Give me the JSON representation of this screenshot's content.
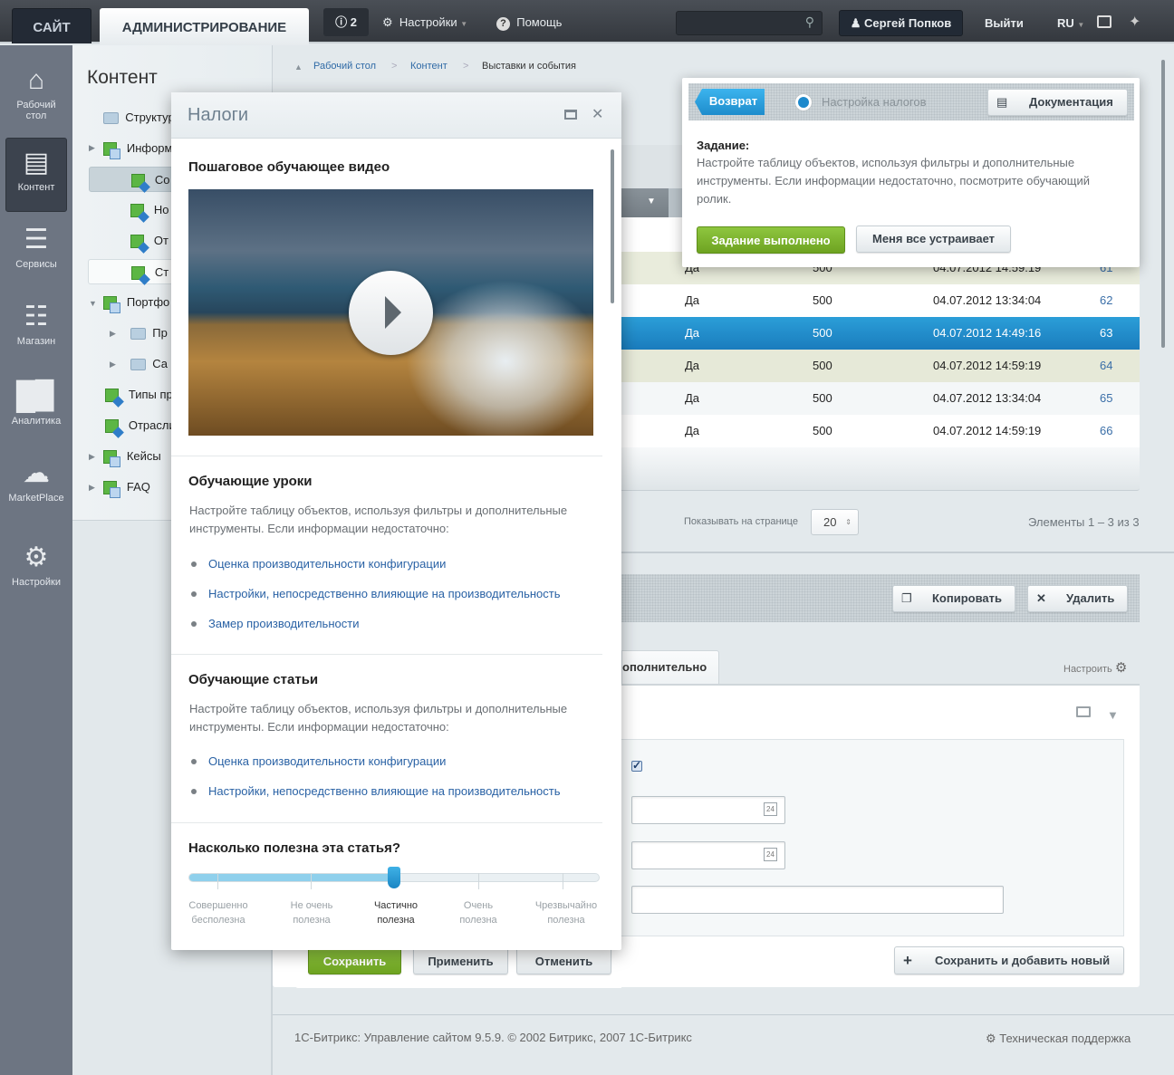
{
  "topbar": {
    "site_tab": "САЙТ",
    "admin_tab": "АДМИНИСТРИРОВАНИЕ",
    "notifications_count": "2",
    "settings": "Настройки",
    "help": "Помощь",
    "search_placeholder": "",
    "user": "Сергей Попков",
    "logout": "Выйти",
    "lang": "RU"
  },
  "leftnav": [
    {
      "label": "Рабочий стол",
      "icon": "home-icon"
    },
    {
      "label": "Контент",
      "icon": "document-icon",
      "active": true
    },
    {
      "label": "Сервисы",
      "icon": "layers-icon"
    },
    {
      "label": "Магазин",
      "icon": "basket-icon"
    },
    {
      "label": "Аналитика",
      "icon": "bar-chart-icon"
    },
    {
      "label": "MarketPlace",
      "icon": "cloud-download-icon"
    },
    {
      "label": "Настройки",
      "icon": "gear-icon"
    }
  ],
  "tree": {
    "title": "Контент",
    "items": [
      "Структура",
      "Информ",
      "Со",
      "Но",
      "От",
      "Ст",
      "Портфо",
      "Пр",
      "Са",
      "Типы пр",
      "Отрасли",
      "Кейсы",
      "FAQ"
    ]
  },
  "breadcrumb": [
    "Рабочий стол",
    "Контент",
    "Выставки и события"
  ],
  "table": {
    "rows": [
      {
        "active": "Да",
        "sort": "500",
        "date": "04.07.2012 14:59:19",
        "id": "61"
      },
      {
        "active": "Да",
        "sort": "500",
        "date": "04.07.2012 13:34:04",
        "id": "62"
      },
      {
        "active": "Да",
        "sort": "500",
        "date": "04.07.2012 14:49:16",
        "id": "63",
        "selected": true
      },
      {
        "active": "Да",
        "sort": "500",
        "date": "04.07.2012 14:59:19",
        "id": "64"
      },
      {
        "active": "Да",
        "sort": "500",
        "date": "04.07.2012 13:34:04",
        "id": "65"
      },
      {
        "active": "Да",
        "sort": "500",
        "date": "04.07.2012 14:59:19",
        "id": "66"
      }
    ]
  },
  "pagination": {
    "label": "Показывать на странице",
    "per_page": "20",
    "summary": "Элементы 1 – 3 из 3"
  },
  "toolbar": {
    "copy": "Копировать",
    "delete": "Удалить"
  },
  "tabs": {
    "extra": "ополнительно",
    "configure": "Настроить"
  },
  "form": {
    "checkbox_checked": true,
    "date1": "",
    "date2": "",
    "text": ""
  },
  "buttons": {
    "save": "Сохранить",
    "apply": "Применить",
    "cancel": "Отменить",
    "save_add": "Сохранить и добавить новый"
  },
  "footer": {
    "copyright": "1С-Битрикс: Управление сайтом 9.5.9. © 2002 Битрикс, 2007 1С-Битрикс",
    "support": "Техническая поддержка"
  },
  "modal": {
    "title": "Налоги",
    "video_heading": "Пошаговое обучающее видео",
    "lessons": {
      "heading": "Обучающие уроки",
      "text": "Настройте таблицу объектов, используя фильтры и дополнительные инструменты. Если информации недостаточно:",
      "links": [
        "Оценка производительности конфигурации",
        "Настройки, непосредственно влияющие на производительность",
        "Замер производительности"
      ]
    },
    "articles": {
      "heading": "Обучающие статьи",
      "text": "Настройте таблицу объектов, используя фильтры и дополнительные инструменты. Если информации недостаточно:",
      "links": [
        "Оценка производительности конфигурации",
        "Настройки, непосредственно влияющие на производительность"
      ]
    },
    "rating": {
      "question": "Насколько полезна эта статья?",
      "selected_index": 2,
      "labels": [
        [
          "Совершенно",
          "бесполезна"
        ],
        [
          "Не очень",
          "полезна"
        ],
        [
          "Частично",
          "полезна"
        ],
        [
          "Очень",
          "полезна"
        ],
        [
          "Чрезвычайно",
          "полезна"
        ]
      ]
    }
  },
  "tip": {
    "back": "Возврат",
    "step": "Настройка налогов",
    "docs": "Документация",
    "task_label": "Задание:",
    "task_text": "Настройте таблицу объектов, используя фильтры и дополнительные инструменты. Если информации недостаточно, посмотрите обучающий ролик.",
    "done": "Задание выполнено",
    "ok": "Меня все устраивает"
  },
  "colors": {
    "accent_blue": "#1f8ccc",
    "green": "#7cb32c",
    "topbar": "#3a3f45",
    "sidebar": "#6d7582"
  }
}
